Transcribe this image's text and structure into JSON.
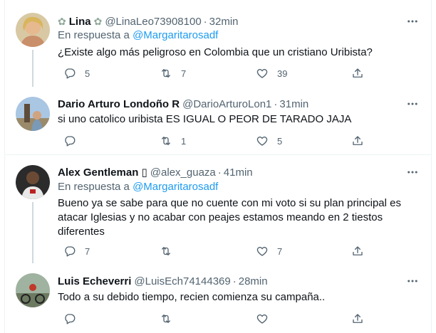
{
  "tweets": [
    {
      "name_prefix_icon": "leaf-emoji",
      "name": "Lina",
      "name_suffix_icon": "leaf-emoji",
      "handle": "@LinaLeo73908100",
      "separator": "·",
      "time": "32min",
      "reply_prefix": "En respuesta a",
      "reply_mention": "@Margaritarosadf",
      "text": "¿Existe algo más peligroso en Colombia que un cristiano Uribista?",
      "replies": "5",
      "retweets": "7",
      "likes": "39"
    },
    {
      "name": "Dario Arturo Londoño R",
      "handle": "@DarioArturoLon1",
      "separator": "·",
      "time": "31min",
      "text": "si uno catolico uribista ES IGUAL O PEOR DE TARADO JAJA",
      "replies": "",
      "retweets": "1",
      "likes": "5"
    },
    {
      "name": "Alex Gentleman ▯",
      "handle": "@alex_guaza",
      "separator": "·",
      "time": "41min",
      "reply_prefix": "En respuesta a",
      "reply_mention": "@Margaritarosadf",
      "text_lines": [
        "Bueno ya se sabe para que no cuente con mi voto si su plan principal es",
        "atacar Iglesias y no acabar con peajes estamos meando en 2 tiestos",
        "diferentes"
      ],
      "replies": "7",
      "retweets": "",
      "likes": "7"
    },
    {
      "name": "Luis Echeverri",
      "handle": "@LuisEch74144369",
      "separator": "·",
      "time": "28min",
      "text": "Todo a su debido tiempo, recien comienza su campaña..",
      "replies": "",
      "retweets": "",
      "likes": ""
    }
  ],
  "icons": {
    "reply": "reply-icon",
    "retweet": "retweet-icon",
    "like": "like-icon",
    "share": "share-icon",
    "more": "more-icon"
  },
  "colors": {
    "link": "#1d9bf0",
    "secondary_text": "#536471",
    "divider": "#eff3f4",
    "thread_line": "#cfd9de"
  }
}
